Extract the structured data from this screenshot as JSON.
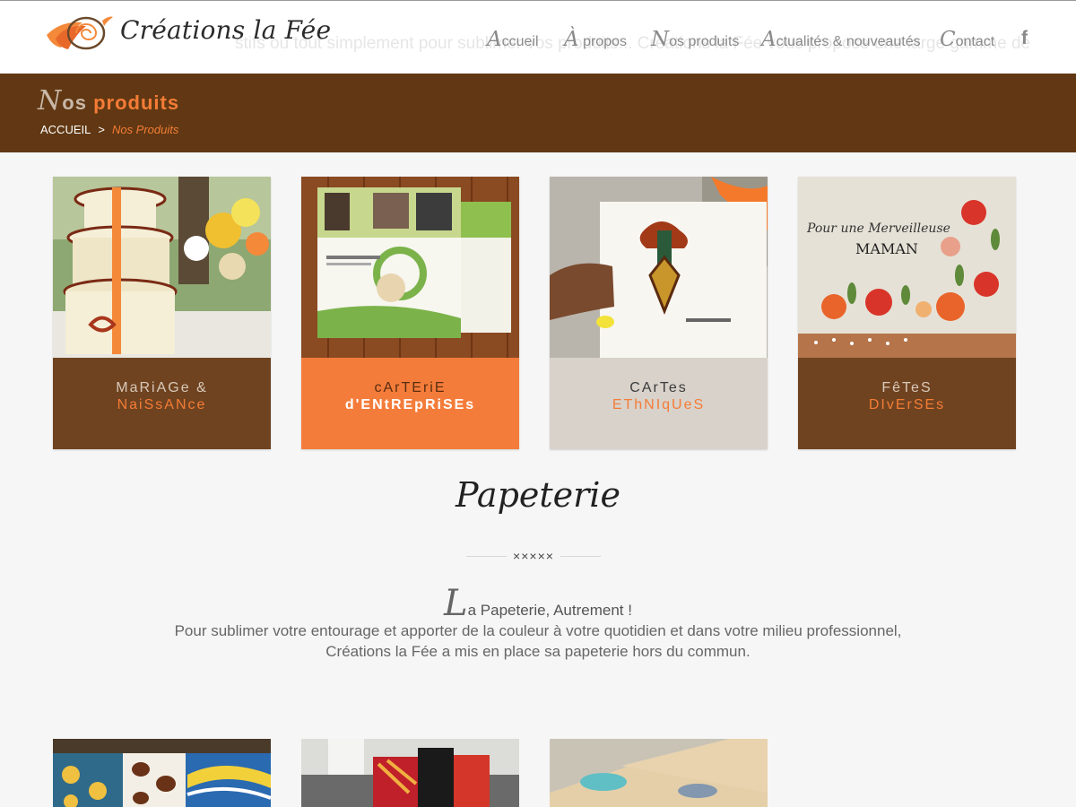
{
  "header": {
    "logo_text": "Créations la Fée",
    "ghost_text": "stifs ou tout simplement pour sublimer vos produits... Créations la Fée vous propose une large gamme de",
    "nav": [
      {
        "cap": "A",
        "rest": "ccueil"
      },
      {
        "cap": "À",
        "rest": " propos"
      },
      {
        "cap": "N",
        "rest": "os produits"
      },
      {
        "cap": "A",
        "rest": "ctualités & nouveautés"
      },
      {
        "cap": "C",
        "rest": "ontact"
      }
    ],
    "facebook_label": "f"
  },
  "banner": {
    "title_cap": "N",
    "title_rest1": "os",
    "title_rest2": "produits",
    "breadcrumb_home": "ACCUEIL",
    "breadcrumb_sep": ">",
    "breadcrumb_current": "Nos Produits"
  },
  "categories": [
    {
      "line1": "MaRiAGe &",
      "line2": "NaiSsANce",
      "bg": "#6f4320",
      "c1": "#d9c9b9",
      "c2": "#f47c36"
    },
    {
      "line1": "cArTEriE",
      "line2": "d'ENtREpRiSEs",
      "bg": "#f47c3a",
      "c1": "#5a2d10",
      "c2": "#ffffff"
    },
    {
      "line1": "CArTes",
      "line2": "EThNIqUeS",
      "bg": "#d8d2cb",
      "c1": "#3b3b3b",
      "c2": "#f47c36"
    },
    {
      "line1": "FêTeS",
      "line2": "DIvErSEs",
      "bg": "#6f4320",
      "c1": "#d9c9b9",
      "c2": "#f47c36"
    }
  ],
  "section": {
    "title": "Papeterie",
    "divider": "×××××",
    "intro_cap": "L",
    "intro_rest": "a Papeterie, Autrement !",
    "intro_line1": "Pour sublimer votre entourage et apporter de la couleur à votre quotidien et dans votre milieu professionnel,",
    "intro_line2": "Créations la Fée a mis en place sa papeterie hors du commun."
  },
  "colors": {
    "accent": "#f47c36",
    "brown": "#613813",
    "card_brown": "#6f4320"
  },
  "icons": [
    "logo-icon",
    "facebook-icon"
  ]
}
